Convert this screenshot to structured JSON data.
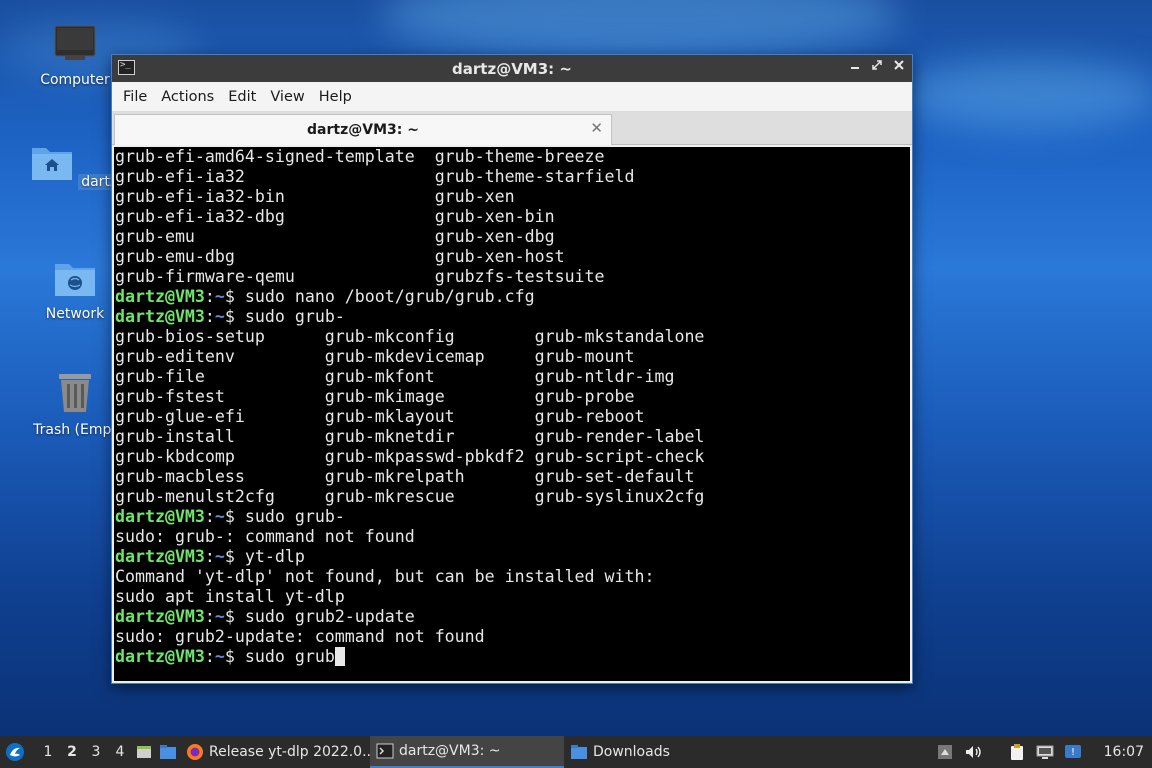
{
  "desktop": {
    "icons": [
      {
        "label": "Computer"
      },
      {
        "label": "dartz"
      },
      {
        "label": "Network"
      },
      {
        "label": "Trash (Empt"
      }
    ]
  },
  "window": {
    "title": "dartz@VM3: ~",
    "menu": [
      "File",
      "Actions",
      "Edit",
      "View",
      "Help"
    ],
    "tab_label": "dartz@VM3: ~",
    "tab_close": "✕"
  },
  "terminal": {
    "prompt_user": "dartz@VM3",
    "prompt_path": "~",
    "lines": [
      {
        "text": "grub-efi-amd64-signed-template  grub-theme-breeze"
      },
      {
        "text": "grub-efi-ia32                   grub-theme-starfield"
      },
      {
        "text": "grub-efi-ia32-bin               grub-xen"
      },
      {
        "text": "grub-efi-ia32-dbg               grub-xen-bin"
      },
      {
        "text": "grub-emu                        grub-xen-dbg"
      },
      {
        "text": "grub-emu-dbg                    grub-xen-host"
      },
      {
        "text": "grub-firmware-qemu              grubzfs-testsuite"
      },
      {
        "cmd": "sudo nano /boot/grub/grub.cfg"
      },
      {
        "cmd": "sudo grub-"
      },
      {
        "text": "grub-bios-setup      grub-mkconfig        grub-mkstandalone"
      },
      {
        "text": "grub-editenv         grub-mkdevicemap     grub-mount"
      },
      {
        "text": "grub-file            grub-mkfont          grub-ntldr-img"
      },
      {
        "text": "grub-fstest          grub-mkimage         grub-probe"
      },
      {
        "text": "grub-glue-efi        grub-mklayout        grub-reboot"
      },
      {
        "text": "grub-install         grub-mknetdir        grub-render-label"
      },
      {
        "text": "grub-kbdcomp         grub-mkpasswd-pbkdf2 grub-script-check"
      },
      {
        "text": "grub-macbless        grub-mkrelpath       grub-set-default"
      },
      {
        "text": "grub-menulst2cfg     grub-mkrescue        grub-syslinux2cfg"
      },
      {
        "cmd": "sudo grub-"
      },
      {
        "text": "sudo: grub-: command not found"
      },
      {
        "cmd": "yt-dlp"
      },
      {
        "text": "Command 'yt-dlp' not found, but can be installed with:"
      },
      {
        "text": "sudo apt install yt-dlp"
      },
      {
        "cmd": "sudo grub2-update"
      },
      {
        "text": "sudo: grub2-update: command not found"
      },
      {
        "cmd": "sudo grub",
        "current": true
      }
    ]
  },
  "taskbar": {
    "workspaces": [
      "1",
      "2",
      "3",
      "4"
    ],
    "active_workspace": "2",
    "tasks": [
      {
        "label": "Release yt-dlp 2022.0...",
        "icon": "firefox-icon"
      },
      {
        "label": "dartz@VM3: ~",
        "icon": "terminal-icon"
      },
      {
        "label": "Downloads",
        "icon": "folder-icon"
      }
    ],
    "clock": "16:07"
  }
}
